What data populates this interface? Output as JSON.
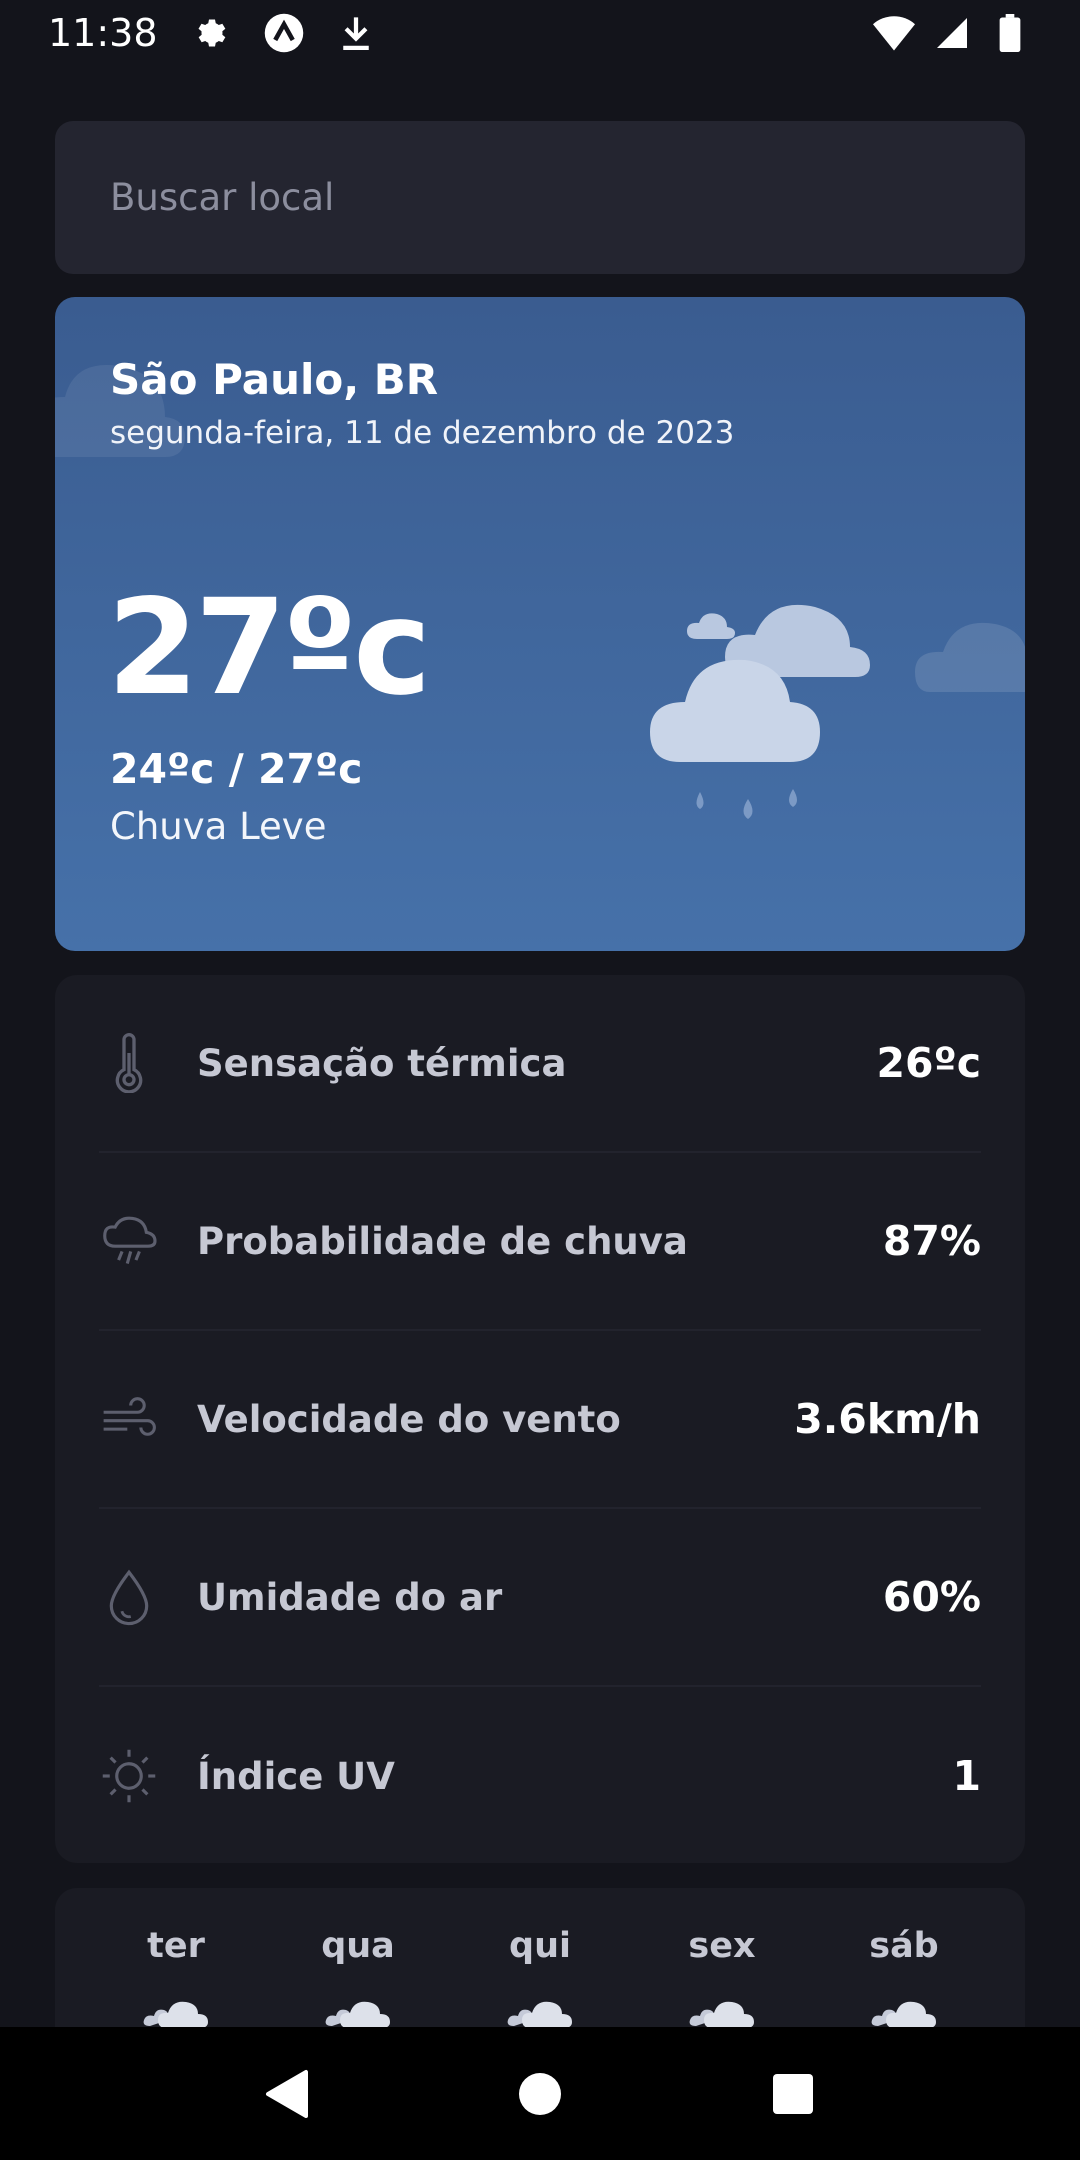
{
  "status_bar": {
    "time": "11:38",
    "icons": [
      "gear-icon",
      "app-logo-icon",
      "download-icon",
      "wifi-icon",
      "cell-signal-icon",
      "battery-icon"
    ]
  },
  "search": {
    "placeholder": "Buscar local"
  },
  "current": {
    "city": "São Paulo, BR",
    "date": "segunda-feira, 11 de dezembro de 2023",
    "temperature": "27ºc",
    "min_max": "24ºc / 27ºc",
    "condition": "Chuva Leve",
    "icon": "rain-cloud-icon"
  },
  "details": [
    {
      "label": "Sensação térmica",
      "value": "26ºc",
      "icon": "thermometer-icon"
    },
    {
      "label": "Probabilidade de chuva",
      "value": "87%",
      "icon": "cloud-rain-icon"
    },
    {
      "label": "Velocidade do vento",
      "value": "3.6km/h",
      "icon": "wind-icon"
    },
    {
      "label": "Umidade do ar",
      "value": "60%",
      "icon": "droplet-icon"
    },
    {
      "label": "Índice UV",
      "value": "1",
      "icon": "sun-icon"
    }
  ],
  "forecast": [
    {
      "day": "ter"
    },
    {
      "day": "qua"
    },
    {
      "day": "qui"
    },
    {
      "day": "sex"
    },
    {
      "day": "sáb"
    }
  ],
  "nav": {
    "buttons": [
      "back-button",
      "home-button",
      "recents-button"
    ]
  },
  "colors": {
    "background": "#13141b",
    "card_gradient_top": "#3a5c90",
    "card_gradient_bottom": "#4671a9",
    "panel": "#1a1b23"
  }
}
